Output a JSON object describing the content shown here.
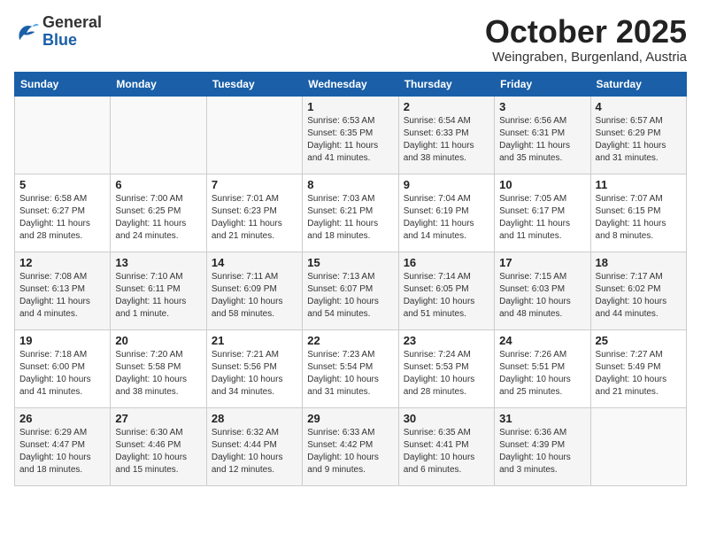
{
  "header": {
    "logo_general": "General",
    "logo_blue": "Blue",
    "month": "October 2025",
    "location": "Weingraben, Burgenland, Austria"
  },
  "weekdays": [
    "Sunday",
    "Monday",
    "Tuesday",
    "Wednesday",
    "Thursday",
    "Friday",
    "Saturday"
  ],
  "weeks": [
    [
      {
        "day": "",
        "info": ""
      },
      {
        "day": "",
        "info": ""
      },
      {
        "day": "",
        "info": ""
      },
      {
        "day": "1",
        "info": "Sunrise: 6:53 AM\nSunset: 6:35 PM\nDaylight: 11 hours and 41 minutes."
      },
      {
        "day": "2",
        "info": "Sunrise: 6:54 AM\nSunset: 6:33 PM\nDaylight: 11 hours and 38 minutes."
      },
      {
        "day": "3",
        "info": "Sunrise: 6:56 AM\nSunset: 6:31 PM\nDaylight: 11 hours and 35 minutes."
      },
      {
        "day": "4",
        "info": "Sunrise: 6:57 AM\nSunset: 6:29 PM\nDaylight: 11 hours and 31 minutes."
      }
    ],
    [
      {
        "day": "5",
        "info": "Sunrise: 6:58 AM\nSunset: 6:27 PM\nDaylight: 11 hours and 28 minutes."
      },
      {
        "day": "6",
        "info": "Sunrise: 7:00 AM\nSunset: 6:25 PM\nDaylight: 11 hours and 24 minutes."
      },
      {
        "day": "7",
        "info": "Sunrise: 7:01 AM\nSunset: 6:23 PM\nDaylight: 11 hours and 21 minutes."
      },
      {
        "day": "8",
        "info": "Sunrise: 7:03 AM\nSunset: 6:21 PM\nDaylight: 11 hours and 18 minutes."
      },
      {
        "day": "9",
        "info": "Sunrise: 7:04 AM\nSunset: 6:19 PM\nDaylight: 11 hours and 14 minutes."
      },
      {
        "day": "10",
        "info": "Sunrise: 7:05 AM\nSunset: 6:17 PM\nDaylight: 11 hours and 11 minutes."
      },
      {
        "day": "11",
        "info": "Sunrise: 7:07 AM\nSunset: 6:15 PM\nDaylight: 11 hours and 8 minutes."
      }
    ],
    [
      {
        "day": "12",
        "info": "Sunrise: 7:08 AM\nSunset: 6:13 PM\nDaylight: 11 hours and 4 minutes."
      },
      {
        "day": "13",
        "info": "Sunrise: 7:10 AM\nSunset: 6:11 PM\nDaylight: 11 hours and 1 minute."
      },
      {
        "day": "14",
        "info": "Sunrise: 7:11 AM\nSunset: 6:09 PM\nDaylight: 10 hours and 58 minutes."
      },
      {
        "day": "15",
        "info": "Sunrise: 7:13 AM\nSunset: 6:07 PM\nDaylight: 10 hours and 54 minutes."
      },
      {
        "day": "16",
        "info": "Sunrise: 7:14 AM\nSunset: 6:05 PM\nDaylight: 10 hours and 51 minutes."
      },
      {
        "day": "17",
        "info": "Sunrise: 7:15 AM\nSunset: 6:03 PM\nDaylight: 10 hours and 48 minutes."
      },
      {
        "day": "18",
        "info": "Sunrise: 7:17 AM\nSunset: 6:02 PM\nDaylight: 10 hours and 44 minutes."
      }
    ],
    [
      {
        "day": "19",
        "info": "Sunrise: 7:18 AM\nSunset: 6:00 PM\nDaylight: 10 hours and 41 minutes."
      },
      {
        "day": "20",
        "info": "Sunrise: 7:20 AM\nSunset: 5:58 PM\nDaylight: 10 hours and 38 minutes."
      },
      {
        "day": "21",
        "info": "Sunrise: 7:21 AM\nSunset: 5:56 PM\nDaylight: 10 hours and 34 minutes."
      },
      {
        "day": "22",
        "info": "Sunrise: 7:23 AM\nSunset: 5:54 PM\nDaylight: 10 hours and 31 minutes."
      },
      {
        "day": "23",
        "info": "Sunrise: 7:24 AM\nSunset: 5:53 PM\nDaylight: 10 hours and 28 minutes."
      },
      {
        "day": "24",
        "info": "Sunrise: 7:26 AM\nSunset: 5:51 PM\nDaylight: 10 hours and 25 minutes."
      },
      {
        "day": "25",
        "info": "Sunrise: 7:27 AM\nSunset: 5:49 PM\nDaylight: 10 hours and 21 minutes."
      }
    ],
    [
      {
        "day": "26",
        "info": "Sunrise: 6:29 AM\nSunset: 4:47 PM\nDaylight: 10 hours and 18 minutes."
      },
      {
        "day": "27",
        "info": "Sunrise: 6:30 AM\nSunset: 4:46 PM\nDaylight: 10 hours and 15 minutes."
      },
      {
        "day": "28",
        "info": "Sunrise: 6:32 AM\nSunset: 4:44 PM\nDaylight: 10 hours and 12 minutes."
      },
      {
        "day": "29",
        "info": "Sunrise: 6:33 AM\nSunset: 4:42 PM\nDaylight: 10 hours and 9 minutes."
      },
      {
        "day": "30",
        "info": "Sunrise: 6:35 AM\nSunset: 4:41 PM\nDaylight: 10 hours and 6 minutes."
      },
      {
        "day": "31",
        "info": "Sunrise: 6:36 AM\nSunset: 4:39 PM\nDaylight: 10 hours and 3 minutes."
      },
      {
        "day": "",
        "info": ""
      }
    ]
  ]
}
